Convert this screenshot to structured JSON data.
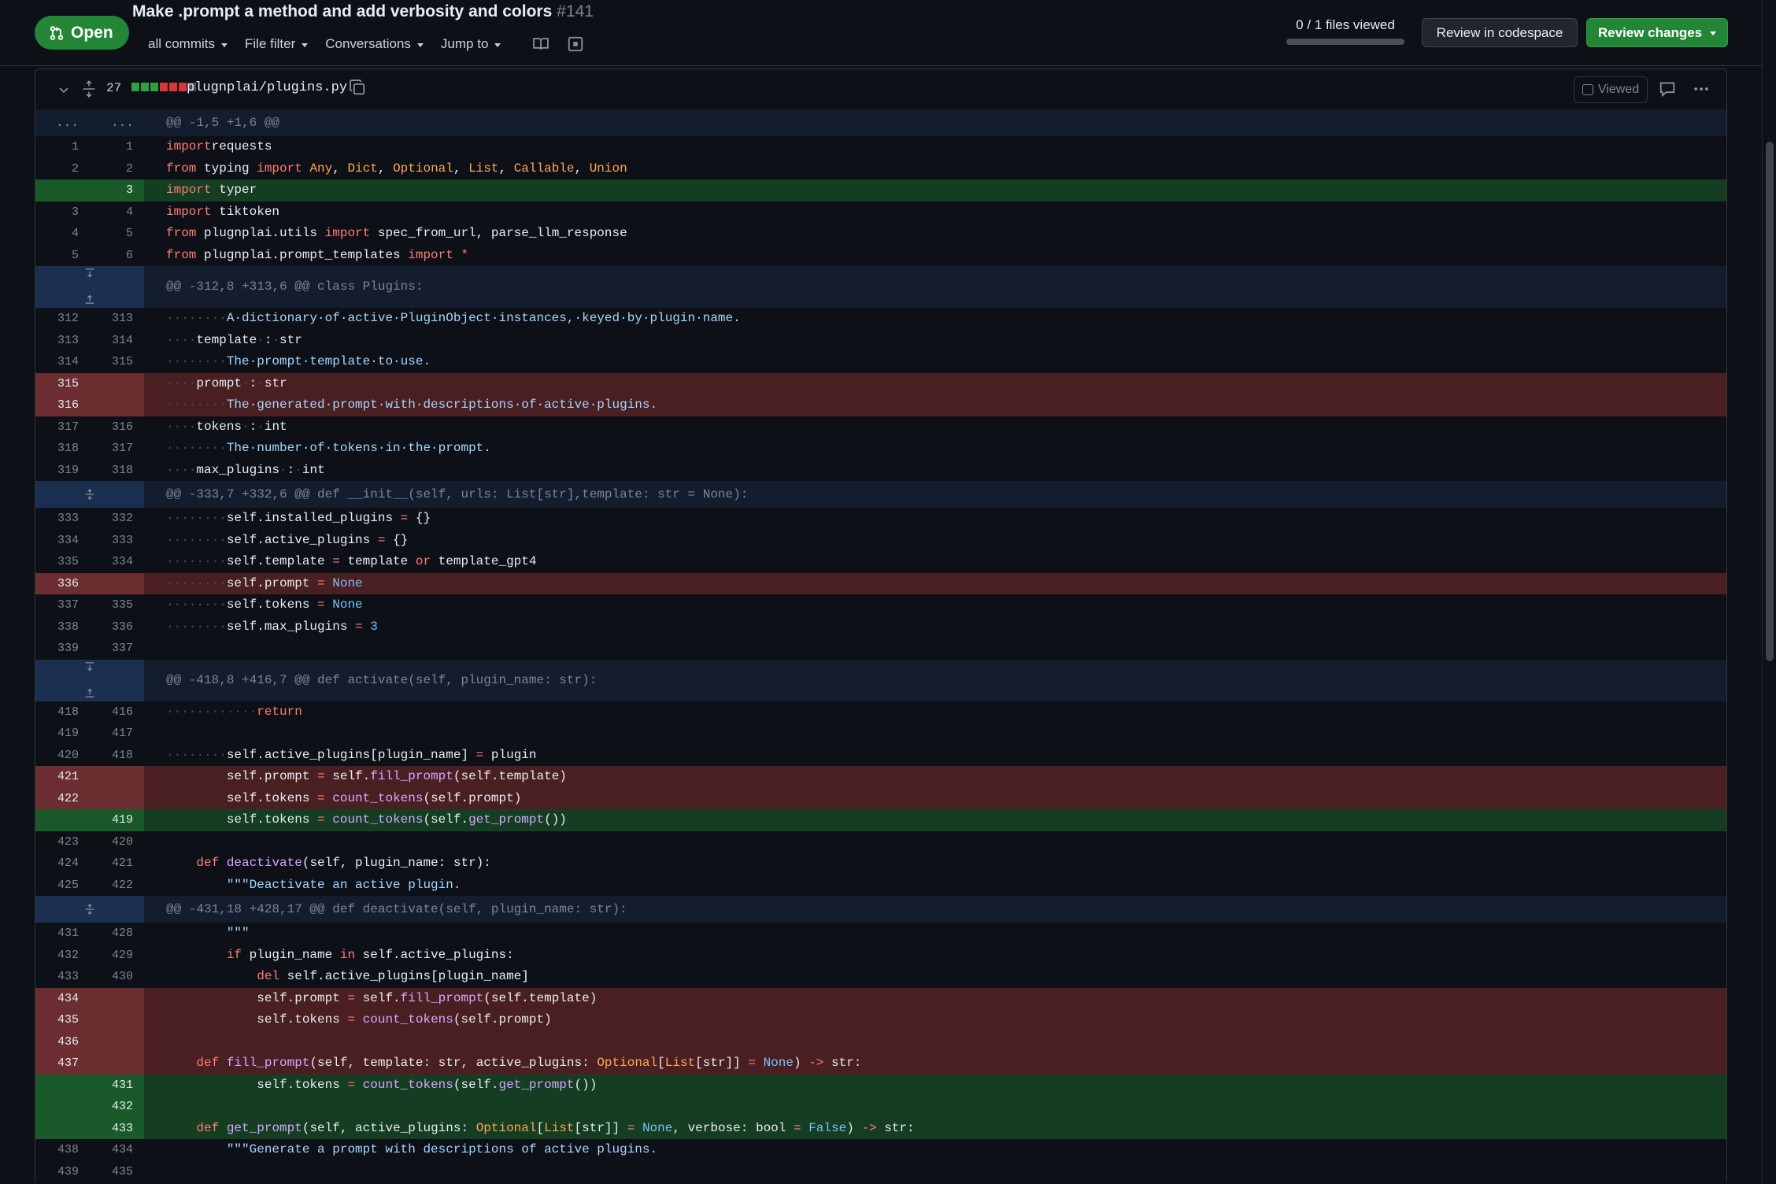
{
  "header": {
    "status": "Open",
    "title": "Make .prompt a method and add verbosity and colors",
    "number": "#141",
    "toolbar": [
      "all commits",
      "File filter",
      "Conversations",
      "Jump to"
    ],
    "files_viewed": "0 / 1 files viewed",
    "files_viewed_fraction": 0,
    "codespace_button": "Review in codespace",
    "review_button": "Review changes",
    "colors": {
      "open": "#238636",
      "bg": "#0d1117"
    }
  },
  "file": {
    "change_count": "27",
    "path": "plugnplai/plugins.py",
    "viewed_label": "Viewed",
    "diffstat": [
      "add",
      "add",
      "add",
      "del",
      "del",
      "del",
      "none"
    ]
  },
  "diff": [
    {
      "type": "hunk",
      "text": "@@ -1,5 +1,6 @@",
      "expander": "dots"
    },
    {
      "type": "ctx",
      "old": "1",
      "new": "1",
      "code": [
        [
          "kw",
          "import"
        ],
        [
          "",
          "requests"
        ]
      ]
    },
    {
      "type": "ctx",
      "old": "2",
      "new": "2",
      "code": [
        [
          "kw",
          "from"
        ],
        [
          "",
          " typing "
        ],
        [
          "kw",
          "import"
        ],
        [
          "",
          " "
        ],
        [
          "bi",
          "Any"
        ],
        [
          "",
          ", "
        ],
        [
          "bi",
          "Dict"
        ],
        [
          "",
          ", "
        ],
        [
          "bi",
          "Optional"
        ],
        [
          "",
          ", "
        ],
        [
          "bi",
          "List"
        ],
        [
          "",
          ", "
        ],
        [
          "bi",
          "Callable"
        ],
        [
          "",
          ", "
        ],
        [
          "bi",
          "Union"
        ]
      ]
    },
    {
      "type": "add",
      "old": "",
      "new": "3",
      "code": [
        [
          "kw",
          "import"
        ],
        [
          "",
          " typer"
        ]
      ]
    },
    {
      "type": "ctx",
      "old": "3",
      "new": "4",
      "code": [
        [
          "kw",
          "import"
        ],
        [
          "",
          " tiktoken"
        ]
      ]
    },
    {
      "type": "ctx",
      "old": "4",
      "new": "5",
      "code": [
        [
          "kw",
          "from"
        ],
        [
          "",
          " plugnplai.utils "
        ],
        [
          "kw",
          "import"
        ],
        [
          "",
          " spec_from_url, parse_llm_response"
        ]
      ]
    },
    {
      "type": "ctx",
      "old": "5",
      "new": "6",
      "code": [
        [
          "kw",
          "from"
        ],
        [
          "",
          " plugnplai.prompt_templates "
        ],
        [
          "kw",
          "import"
        ],
        [
          "",
          " "
        ],
        [
          "kw",
          "*"
        ]
      ]
    },
    {
      "type": "hunk",
      "text": "@@ -312,8 +313,6 @@ class Plugins:",
      "expander": "updown",
      "tall": true
    },
    {
      "type": "ctx",
      "old": "312",
      "new": "313",
      "code": [
        [
          "ws",
          "········"
        ],
        [
          "str",
          "A·dictionary·of·active·PluginObject·instances,·keyed·by·plugin·name."
        ]
      ]
    },
    {
      "type": "ctx",
      "old": "313",
      "new": "314",
      "code": [
        [
          "ws",
          "····"
        ],
        [
          "",
          "template"
        ],
        [
          "ws",
          "·"
        ],
        [
          "",
          ":"
        ],
        [
          "ws",
          "·"
        ],
        [
          "",
          "str"
        ]
      ]
    },
    {
      "type": "ctx",
      "old": "314",
      "new": "315",
      "code": [
        [
          "ws",
          "········"
        ],
        [
          "str",
          "The·prompt·template·to·use."
        ]
      ]
    },
    {
      "type": "del",
      "old": "315",
      "new": "",
      "code": [
        [
          "ws",
          "····"
        ],
        [
          "",
          "prompt"
        ],
        [
          "ws",
          "·"
        ],
        [
          "",
          ":"
        ],
        [
          "ws",
          "·"
        ],
        [
          "",
          "str"
        ]
      ]
    },
    {
      "type": "del",
      "old": "316",
      "new": "",
      "code": [
        [
          "ws",
          "········"
        ],
        [
          "str",
          "The·generated·prompt·with·descriptions·of·active·plugins."
        ]
      ]
    },
    {
      "type": "ctx",
      "old": "317",
      "new": "316",
      "code": [
        [
          "ws",
          "····"
        ],
        [
          "",
          "tokens"
        ],
        [
          "ws",
          "·"
        ],
        [
          "",
          ":"
        ],
        [
          "ws",
          "·"
        ],
        [
          "",
          "int"
        ]
      ]
    },
    {
      "type": "ctx",
      "old": "318",
      "new": "317",
      "code": [
        [
          "ws",
          "········"
        ],
        [
          "str",
          "The·number·of·tokens·in·the·prompt."
        ]
      ]
    },
    {
      "type": "ctx",
      "old": "319",
      "new": "318",
      "code": [
        [
          "ws",
          "····"
        ],
        [
          "",
          "max_plugins"
        ],
        [
          "ws",
          "·"
        ],
        [
          "",
          ":"
        ],
        [
          "ws",
          "·"
        ],
        [
          "",
          "int"
        ]
      ]
    },
    {
      "type": "hunk",
      "text": "@@ -333,7 +332,6 @@ def __init__(self, urls: List[str],template: str = None):",
      "expander": "both"
    },
    {
      "type": "ctx",
      "old": "333",
      "new": "332",
      "code": [
        [
          "ws",
          "········"
        ],
        [
          "",
          "self.installed_plugins "
        ],
        [
          "kw",
          "="
        ],
        [
          "",
          " {}"
        ]
      ]
    },
    {
      "type": "ctx",
      "old": "334",
      "new": "333",
      "code": [
        [
          "ws",
          "········"
        ],
        [
          "",
          "self.active_plugins "
        ],
        [
          "kw",
          "="
        ],
        [
          "",
          " {}"
        ]
      ]
    },
    {
      "type": "ctx",
      "old": "335",
      "new": "334",
      "code": [
        [
          "ws",
          "········"
        ],
        [
          "",
          "self.template "
        ],
        [
          "kw",
          "="
        ],
        [
          "",
          " template "
        ],
        [
          "kw",
          "or"
        ],
        [
          "",
          " template_gpt4"
        ]
      ]
    },
    {
      "type": "del",
      "old": "336",
      "new": "",
      "code": [
        [
          "ws",
          "········"
        ],
        [
          "",
          "self.prompt "
        ],
        [
          "kw",
          "="
        ],
        [
          "",
          " "
        ],
        [
          "cn",
          "None"
        ]
      ]
    },
    {
      "type": "ctx",
      "old": "337",
      "new": "335",
      "code": [
        [
          "ws",
          "········"
        ],
        [
          "",
          "self.tokens "
        ],
        [
          "kw",
          "="
        ],
        [
          "",
          " "
        ],
        [
          "cn",
          "None"
        ]
      ]
    },
    {
      "type": "ctx",
      "old": "338",
      "new": "336",
      "code": [
        [
          "ws",
          "········"
        ],
        [
          "",
          "self.max_plugins "
        ],
        [
          "kw",
          "="
        ],
        [
          "",
          " "
        ],
        [
          "cn",
          "3"
        ]
      ]
    },
    {
      "type": "ctx",
      "old": "339",
      "new": "337",
      "code": []
    },
    {
      "type": "hunk",
      "text": "@@ -418,8 +416,7 @@ def activate(self, plugin_name: str):",
      "expander": "updown",
      "tall": true
    },
    {
      "type": "ctx",
      "old": "418",
      "new": "416",
      "code": [
        [
          "ws",
          "············"
        ],
        [
          "kw",
          "return"
        ]
      ]
    },
    {
      "type": "ctx",
      "old": "419",
      "new": "417",
      "code": []
    },
    {
      "type": "ctx",
      "old": "420",
      "new": "418",
      "code": [
        [
          "ws",
          "········"
        ],
        [
          "",
          "self.active_plugins[plugin_name] "
        ],
        [
          "kw",
          "="
        ],
        [
          "",
          " plugin"
        ]
      ]
    },
    {
      "type": "del",
      "old": "421",
      "new": "",
      "code": [
        [
          "",
          "        self.prompt "
        ],
        [
          "kw",
          "="
        ],
        [
          "",
          " self."
        ],
        [
          "fn",
          "fill_prompt"
        ],
        [
          "",
          "(self.template)"
        ]
      ]
    },
    {
      "type": "del",
      "old": "422",
      "new": "",
      "code": [
        [
          "",
          "        self.tokens "
        ],
        [
          "kw",
          "="
        ],
        [
          "",
          " "
        ],
        [
          "fn",
          "count_tokens"
        ],
        [
          "",
          "(self.prompt)"
        ]
      ]
    },
    {
      "type": "add",
      "old": "",
      "new": "419",
      "code": [
        [
          "",
          "        self.tokens "
        ],
        [
          "kw",
          "="
        ],
        [
          "",
          " "
        ],
        [
          "fn",
          "count_tokens"
        ],
        [
          "",
          "(self."
        ],
        [
          "fn",
          "get_prompt"
        ],
        [
          "",
          "())"
        ]
      ]
    },
    {
      "type": "ctx",
      "old": "423",
      "new": "420",
      "code": []
    },
    {
      "type": "ctx",
      "old": "424",
      "new": "421",
      "code": [
        [
          "",
          "    "
        ],
        [
          "kw",
          "def"
        ],
        [
          "",
          " "
        ],
        [
          "fn",
          "deactivate"
        ],
        [
          "",
          "(self, plugin_name: str):"
        ]
      ]
    },
    {
      "type": "ctx",
      "old": "425",
      "new": "422",
      "code": [
        [
          "",
          "        "
        ],
        [
          "str",
          "\"\"\"Deactivate an active plugin."
        ]
      ]
    },
    {
      "type": "hunk",
      "text": "@@ -431,18 +428,17 @@ def deactivate(self, plugin_name: str):",
      "expander": "both"
    },
    {
      "type": "ctx",
      "old": "431",
      "new": "428",
      "code": [
        [
          "",
          "        "
        ],
        [
          "str",
          "\"\"\""
        ]
      ]
    },
    {
      "type": "ctx",
      "old": "432",
      "new": "429",
      "code": [
        [
          "",
          "        "
        ],
        [
          "kw",
          "if"
        ],
        [
          "",
          " plugin_name "
        ],
        [
          "kw",
          "in"
        ],
        [
          "",
          " self.active_plugins:"
        ]
      ]
    },
    {
      "type": "ctx",
      "old": "433",
      "new": "430",
      "code": [
        [
          "",
          "            "
        ],
        [
          "kw",
          "del"
        ],
        [
          "",
          " self.active_plugins[plugin_name]"
        ]
      ]
    },
    {
      "type": "del",
      "old": "434",
      "new": "",
      "code": [
        [
          "",
          "            self.prompt "
        ],
        [
          "kw",
          "="
        ],
        [
          "",
          " self."
        ],
        [
          "fn",
          "fill_prompt"
        ],
        [
          "",
          "(self.template)"
        ]
      ]
    },
    {
      "type": "del",
      "old": "435",
      "new": "",
      "code": [
        [
          "",
          "            self.tokens "
        ],
        [
          "kw",
          "="
        ],
        [
          "",
          " "
        ],
        [
          "fn",
          "count_tokens"
        ],
        [
          "",
          "(self.prompt)"
        ]
      ]
    },
    {
      "type": "del",
      "old": "436",
      "new": "",
      "code": []
    },
    {
      "type": "del",
      "old": "437",
      "new": "",
      "code": [
        [
          "",
          "    "
        ],
        [
          "kw",
          "def"
        ],
        [
          "",
          " "
        ],
        [
          "fn",
          "fill_prompt"
        ],
        [
          "",
          "(self, template: str, active_plugins: "
        ],
        [
          "bi",
          "Optional"
        ],
        [
          "",
          "["
        ],
        [
          "bi",
          "List"
        ],
        [
          "",
          "[str]] "
        ],
        [
          "kw",
          "="
        ],
        [
          "",
          " "
        ],
        [
          "cn",
          "None"
        ],
        [
          "",
          ") "
        ],
        [
          "kw",
          "->"
        ],
        [
          "",
          " str:"
        ]
      ]
    },
    {
      "type": "add",
      "old": "",
      "new": "431",
      "code": [
        [
          "",
          "            self.tokens "
        ],
        [
          "kw",
          "="
        ],
        [
          "",
          " "
        ],
        [
          "fn",
          "count_tokens"
        ],
        [
          "",
          "(self."
        ],
        [
          "fn",
          "get_prompt"
        ],
        [
          "",
          "())"
        ]
      ]
    },
    {
      "type": "add",
      "old": "",
      "new": "432",
      "code": []
    },
    {
      "type": "add",
      "old": "",
      "new": "433",
      "code": [
        [
          "",
          "    "
        ],
        [
          "kw",
          "def"
        ],
        [
          "",
          " "
        ],
        [
          "fn",
          "get_prompt"
        ],
        [
          "",
          "(self, active_plugins: "
        ],
        [
          "bi",
          "Optional"
        ],
        [
          "",
          "["
        ],
        [
          "bi",
          "List"
        ],
        [
          "",
          "[str]] "
        ],
        [
          "kw",
          "="
        ],
        [
          "",
          " "
        ],
        [
          "cn",
          "None"
        ],
        [
          "",
          ", verbose: bool "
        ],
        [
          "kw",
          "="
        ],
        [
          "",
          " "
        ],
        [
          "cn",
          "False"
        ],
        [
          "",
          ") "
        ],
        [
          "kw",
          "->"
        ],
        [
          "",
          " str:"
        ]
      ]
    },
    {
      "type": "ctx",
      "old": "438",
      "new": "434",
      "code": [
        [
          "",
          "        "
        ],
        [
          "str",
          "\"\"\"Generate a prompt with descriptions of active plugins."
        ]
      ]
    },
    {
      "type": "ctx",
      "old": "439",
      "new": "435",
      "code": []
    }
  ]
}
